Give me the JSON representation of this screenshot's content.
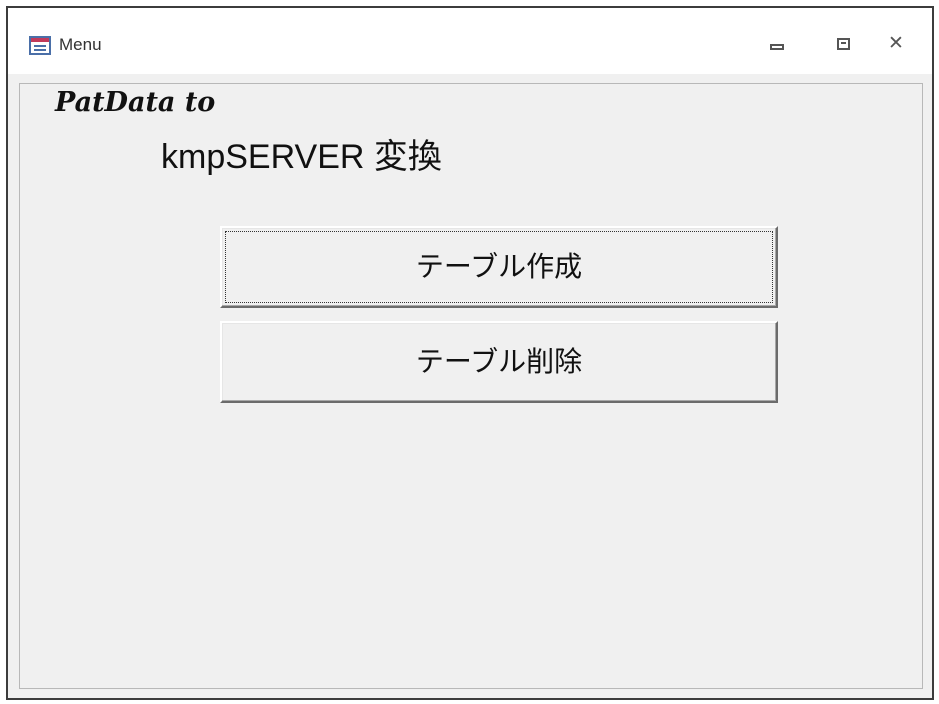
{
  "window": {
    "title": "Menu",
    "app_icon": "form-icon",
    "controls": {
      "minimize_icon": "minimize-icon",
      "maximize_icon": "maximize-icon",
      "close_icon": "close-icon"
    }
  },
  "form": {
    "heading_line1": "PatData to",
    "heading_line2": "kmpSERVER 変換",
    "buttons": {
      "create_table": "テーブル作成",
      "delete_table": "テーブル削除"
    },
    "focused_button": "create_table"
  },
  "colors": {
    "window_border": "#3c3c3c",
    "form_background": "#f0f0f0",
    "titlebar_background": "#ffffff"
  }
}
